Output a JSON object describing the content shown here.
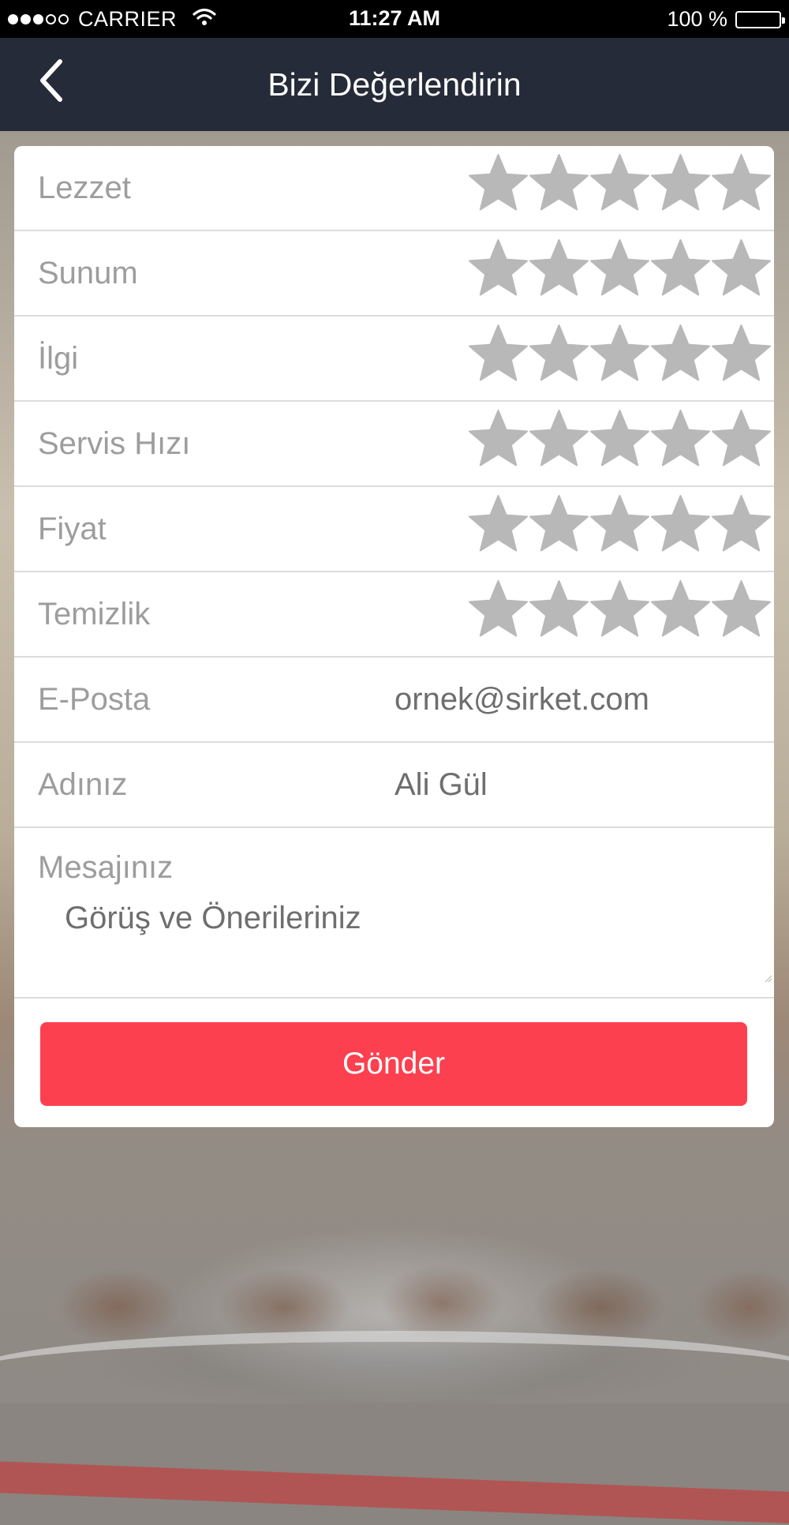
{
  "status_bar": {
    "carrier": "CARRIER",
    "time": "11:27 AM",
    "battery": "100 %",
    "signal_bars_filled": 3,
    "signal_bars_total": 5
  },
  "nav": {
    "title": "Bizi Değerlendirin",
    "back_icon": "chevron-left-icon"
  },
  "ratings": [
    {
      "label": "Lezzet",
      "stars": 0,
      "max": 5
    },
    {
      "label": "Sunum",
      "stars": 0,
      "max": 5
    },
    {
      "label": "İlgi",
      "stars": 0,
      "max": 5
    },
    {
      "label": "Servis Hızı",
      "stars": 0,
      "max": 5
    },
    {
      "label": "Fiyat",
      "stars": 0,
      "max": 5
    },
    {
      "label": "Temizlik",
      "stars": 0,
      "max": 5
    }
  ],
  "form": {
    "email": {
      "label": "E-Posta",
      "placeholder": "ornek@sirket.com"
    },
    "name": {
      "label": "Adınız",
      "placeholder": "Ali Gül"
    },
    "message": {
      "label": "Mesajınız",
      "placeholder": "Görüş ve Önerileriniz"
    }
  },
  "submit_label": "Gönder",
  "colors": {
    "navbar": "#262b39",
    "button": "#fc404f",
    "star_empty": "#b8b8b8",
    "label": "#9d9d9d"
  }
}
